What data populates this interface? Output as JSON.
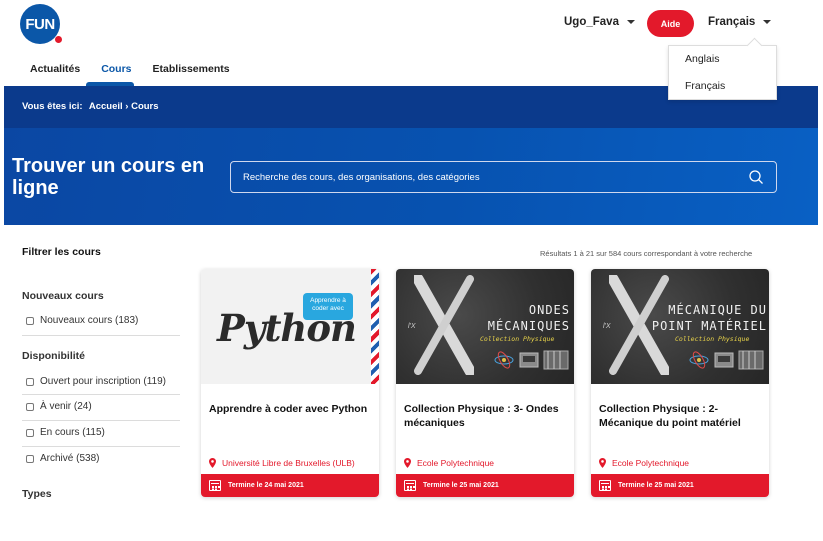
{
  "header": {
    "logo_text": "FUN",
    "user_name": "Ugo_Fava",
    "help_label": "Aide",
    "language": "Français",
    "language_options": [
      "Anglais",
      "Français"
    ]
  },
  "nav": {
    "items": [
      "Actualités",
      "Cours",
      "Etablissements"
    ],
    "active": "Cours"
  },
  "breadcrumb": {
    "prefix": "Vous êtes ici:",
    "path": "Accueil › Cours"
  },
  "hero": {
    "title": "Trouver un cours en ligne",
    "search_placeholder": "Recherche des cours, des organisations, des catégories"
  },
  "filters": {
    "title": "Filtrer les cours",
    "groups": [
      {
        "label": "Nouveaux cours",
        "items": [
          "Nouveaux cours (183)"
        ]
      },
      {
        "label": "Disponibilité",
        "items": [
          "Ouvert pour inscription (119)",
          "À venir (24)",
          "En cours (115)",
          "Archivé (538)"
        ]
      },
      {
        "label": "Types",
        "items": []
      }
    ]
  },
  "results": {
    "count_text": "Résultats 1 à 21 sur 584 cours correspondant à votre recherche"
  },
  "courses": [
    {
      "title": "Apprendre à coder avec Python",
      "organization": "Université Libre de Bruxelles (ULB)",
      "end_date": "Termine le 24 mai 2021",
      "image_word": "Python",
      "image_bubble": "Apprendre à coder avec"
    },
    {
      "title": "Collection Physique : 3- Ondes mécaniques",
      "organization": "Ecole Polytechnique",
      "end_date": "Termine le 25 mai 2021",
      "image_title_1": "ONDES",
      "image_title_2": "MÉCANIQUES",
      "image_subtitle": "Collection Physique",
      "image_letter": "l'X"
    },
    {
      "title": "Collection Physique : 2- Mécanique du point matériel",
      "organization": "Ecole Polytechnique",
      "end_date": "Termine le 25 mai 2021",
      "image_title_1": "MÉCANIQUE DU",
      "image_title_2": "POINT MATÉRIEL",
      "image_subtitle": "Collection Physique",
      "image_letter": "l'X"
    }
  ],
  "colors": {
    "brand_blue": "#0b57a8",
    "hero_blue": "#0b3a8c",
    "accent_red": "#e3192b"
  }
}
